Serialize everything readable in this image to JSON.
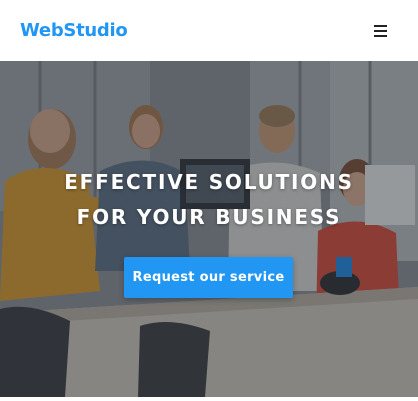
{
  "header": {
    "logo_web": "Web",
    "logo_studio": "Studio",
    "menu_icon": "hamburger-menu-icon"
  },
  "hero": {
    "title_line1": "EFFECTIVE SOLUTIONS",
    "title_line2": "FOR YOUR BUSINESS",
    "cta_label": "Request our service"
  },
  "colors": {
    "brand": "#2196f3",
    "cta_background": "#2196f3",
    "hero_text": "#ffffff"
  }
}
